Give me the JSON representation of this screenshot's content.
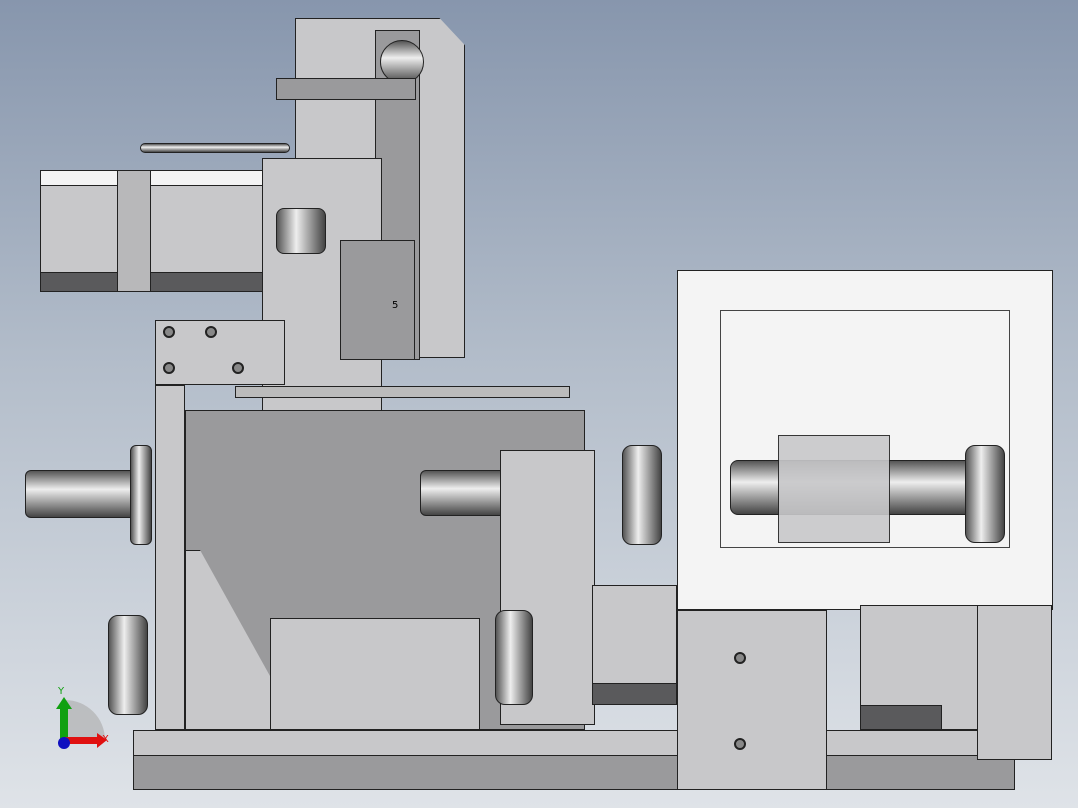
{
  "viewport": {
    "part_label": "5"
  },
  "triad": {
    "x_label": "X",
    "y_label": "Y",
    "x_color": "#e01010",
    "y_color": "#10a010",
    "z_color": "#1010c0"
  }
}
